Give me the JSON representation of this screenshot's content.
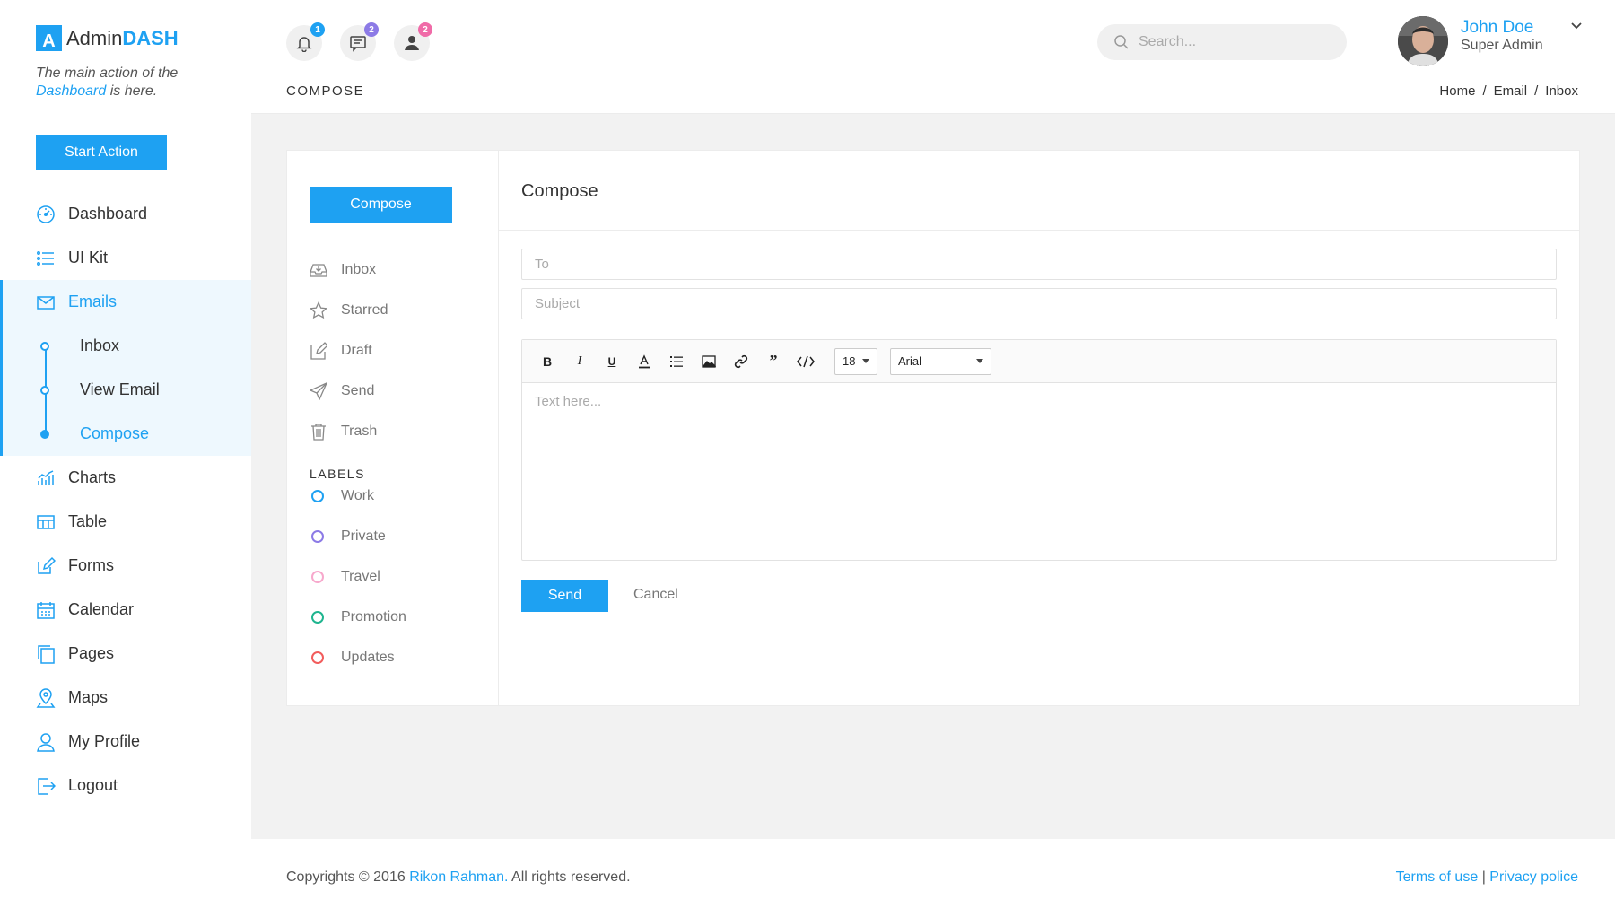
{
  "brand": {
    "prefix": "Admin",
    "strong": "DASH",
    "mark": "A"
  },
  "tagline": {
    "before": "The main action of the",
    "highlight": "Dashboard",
    "after": "is here."
  },
  "sidebar": {
    "start_action": "Start Action",
    "items_top": [
      {
        "label": "Dashboard",
        "icon": "dashboard-icon"
      },
      {
        "label": "UI Kit",
        "icon": "list-icon"
      }
    ],
    "emails": {
      "label": "Emails",
      "icon": "mail-icon",
      "children": [
        "Inbox",
        "View Email",
        "Compose"
      ],
      "active_child": "Compose"
    },
    "items_bottom": [
      {
        "label": "Charts",
        "icon": "chart-icon"
      },
      {
        "label": "Table",
        "icon": "table-icon"
      },
      {
        "label": "Forms",
        "icon": "edit-icon"
      },
      {
        "label": "Calendar",
        "icon": "calendar-icon"
      },
      {
        "label": "Pages",
        "icon": "pages-icon"
      },
      {
        "label": "Maps",
        "icon": "map-pin-icon"
      },
      {
        "label": "My Profile",
        "icon": "user-icon"
      },
      {
        "label": "Logout",
        "icon": "logout-icon"
      }
    ]
  },
  "header": {
    "notifications": [
      {
        "icon": "bell-icon",
        "count": "1",
        "color": "#1ea1f2"
      },
      {
        "icon": "message-icon",
        "count": "2",
        "color": "#8c7ae6"
      },
      {
        "icon": "user-icon",
        "count": "2",
        "color": "#f06ba8"
      }
    ],
    "page_heading": "COMPOSE",
    "search_placeholder": "Search...",
    "user": {
      "name": "John Doe",
      "role": "Super Admin"
    },
    "breadcrumb": [
      "Home",
      "/",
      "Email",
      "/",
      "Inbox"
    ]
  },
  "mailbox": {
    "compose_label": "Compose",
    "folders": [
      {
        "label": "Inbox",
        "icon": "inbox-icon"
      },
      {
        "label": "Starred",
        "icon": "star-icon"
      },
      {
        "label": "Draft",
        "icon": "draft-icon"
      },
      {
        "label": "Send",
        "icon": "send-icon"
      },
      {
        "label": "Trash",
        "icon": "trash-icon"
      }
    ],
    "labels_title": "LABELS",
    "labels": [
      {
        "label": "Work",
        "color": "#1ea1f2"
      },
      {
        "label": "Private",
        "color": "#8c7ae6"
      },
      {
        "label": "Travel",
        "color": "#f7a8cc"
      },
      {
        "label": "Promotion",
        "color": "#1fb58f"
      },
      {
        "label": "Updates",
        "color": "#f25c5c"
      }
    ]
  },
  "compose": {
    "title": "Compose",
    "to_placeholder": "To",
    "subject_placeholder": "Subject",
    "font_size": "18",
    "font_family": "Arial",
    "body_placeholder": "Text here...",
    "send_label": "Send",
    "cancel_label": "Cancel"
  },
  "footer": {
    "copyright_before": "Copyrights © 2016",
    "author": "Rikon Rahman.",
    "copyright_after": "All rights reserved.",
    "terms": "Terms of use",
    "separator": "|",
    "privacy": "Privacy police"
  },
  "colors": {
    "accent": "#1ea1f2",
    "main_bg": "#f2f2f2"
  }
}
